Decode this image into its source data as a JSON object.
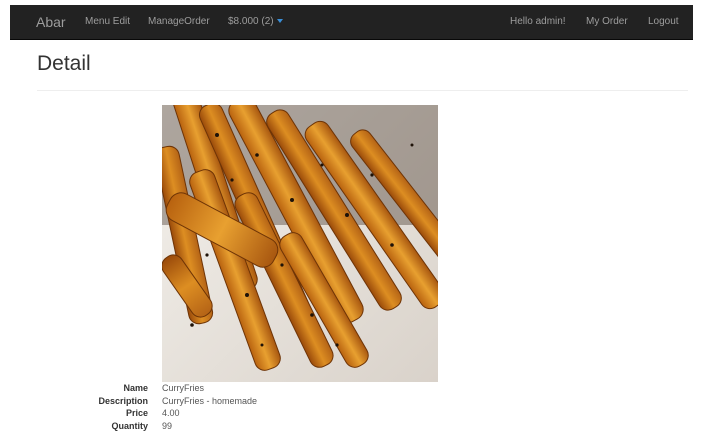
{
  "navbar": {
    "brand": "Abar",
    "menu_edit": "Menu Edit",
    "manage_order": "ManageOrder",
    "cart": "$8.000 (2)",
    "greeting": "Hello admin!",
    "my_order": "My Order",
    "logout": "Logout"
  },
  "page": {
    "title": "Detail"
  },
  "product": {
    "image_icon": "fries-photo",
    "fields": [
      {
        "label": "Name",
        "value": "CurryFries"
      },
      {
        "label": "Description",
        "value": "CurryFries - homemade"
      },
      {
        "label": "Price",
        "value": "4.00"
      },
      {
        "label": "Quantity",
        "value": "99"
      }
    ]
  },
  "colors": {
    "navbar_bg": "#222222",
    "nav_text": "#9d9d9d",
    "caret": "#3a8fd8"
  }
}
